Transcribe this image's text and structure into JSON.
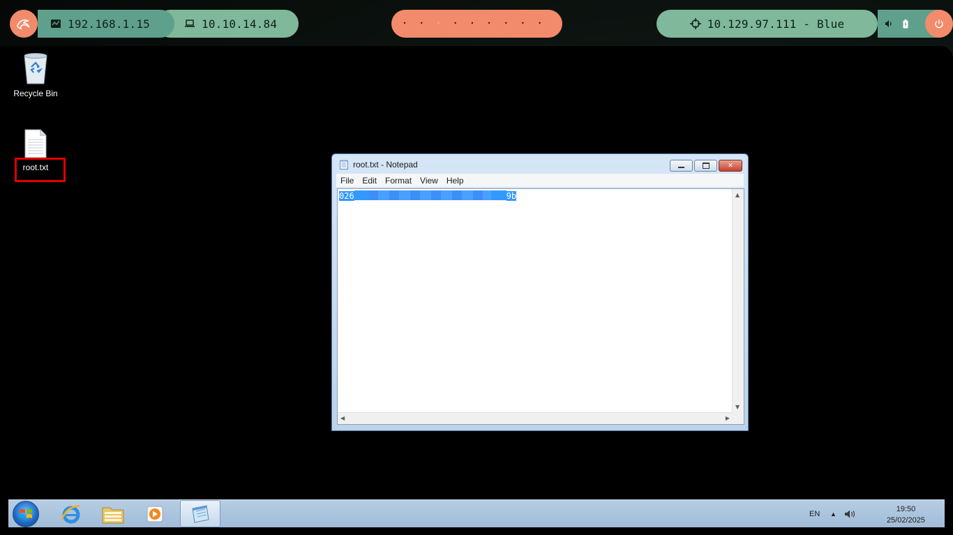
{
  "topbar": {
    "host_ip": "192.168.1.15",
    "vpn_ip": "10.10.14.84",
    "workspaces": [
      "•",
      "•",
      "•",
      "•",
      "•",
      "•",
      "•",
      "•",
      "•"
    ],
    "active_workspace_index": 2,
    "target": "10.129.97.111 - Blue"
  },
  "desktop": {
    "icons": [
      {
        "label": "Recycle Bin"
      },
      {
        "label": "root.txt"
      }
    ]
  },
  "notepad": {
    "title": "root.txt - Notepad",
    "menu": [
      "File",
      "Edit",
      "Format",
      "View",
      "Help"
    ],
    "content_prefix": "026",
    "content_suffix": "9b"
  },
  "taskbar": {
    "language": "EN",
    "time": "19:50",
    "date": "25/02/2025"
  },
  "colors": {
    "accent_orange": "#f28b6b",
    "accent_green": "#7fb89a",
    "accent_teal": "#5fa08c",
    "selection": "#3399ff",
    "highlight_box": "#e00000"
  }
}
